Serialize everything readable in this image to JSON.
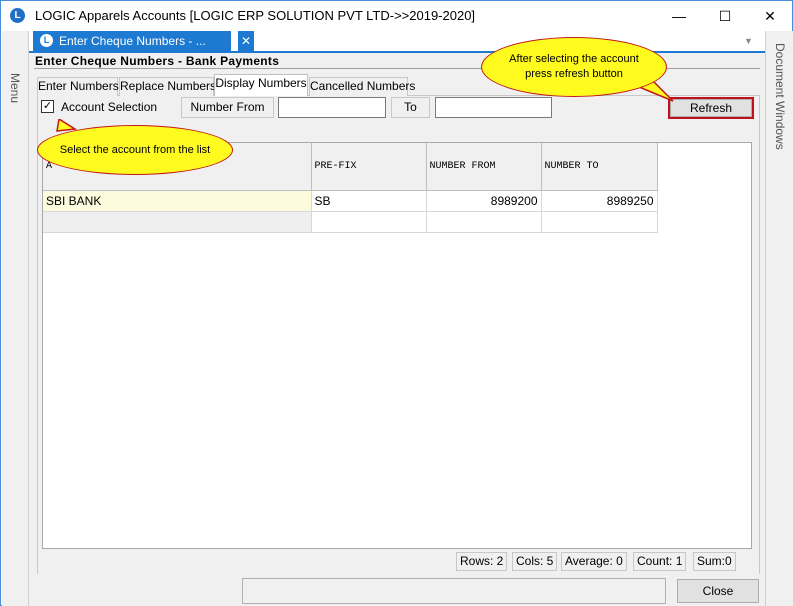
{
  "window": {
    "title": "LOGIC Apparels Accounts  [LOGIC ERP SOLUTION PVT LTD->>2019-2020]",
    "app_icon": "L",
    "min_glyph": "—",
    "max_glyph": "☐",
    "close_glyph": "✕"
  },
  "side_panels": {
    "left_label": "Menu",
    "right_label": "Document Windows"
  },
  "doc_tab": {
    "label": "Enter Cheque Numbers - ...",
    "icon": "L",
    "close_glyph": "✕",
    "dropdown_glyph": "▼"
  },
  "form": {
    "heading": "Enter Cheque Numbers - Bank Payments",
    "tabs": [
      {
        "label": "Enter Numbers",
        "active": false
      },
      {
        "label": "Replace Numbers",
        "active": false
      },
      {
        "label": "Display Numbers",
        "active": true
      },
      {
        "label": "Cancelled Numbers",
        "active": false
      }
    ],
    "account_selection": {
      "label": "Account Selection",
      "checked": true,
      "check_glyph": "✓"
    },
    "number_from_label": "Number From",
    "number_from_value": "",
    "to_label": "To",
    "to_value": "",
    "refresh_label": "Refresh"
  },
  "grid": {
    "columns": [
      "A",
      "PRE-FIX",
      "NUMBER FROM",
      "NUMBER TO"
    ],
    "rows": [
      {
        "account": "SBI BANK",
        "prefix": "SB",
        "number_from": "8989200",
        "number_to": "8989250"
      },
      {
        "account": "",
        "prefix": "",
        "number_from": "",
        "number_to": ""
      }
    ]
  },
  "status": {
    "rows": "Rows: 2",
    "cols": "Cols: 5",
    "average": "Average: 0",
    "count": "Count: 1",
    "sum": "Sum:0"
  },
  "bottom": {
    "close_label": "Close"
  },
  "callouts": {
    "select_account": "Select  the  account  from  the  list",
    "press_refresh": "After  selecting  the  account  press  refresh  button"
  },
  "colors": {
    "accent_blue": "#1e7ad1",
    "callout_fill": "#fffb1e",
    "callout_border": "#c01818",
    "refresh_border": "#c0101c",
    "account_cell_bg": "#fcfbde"
  }
}
